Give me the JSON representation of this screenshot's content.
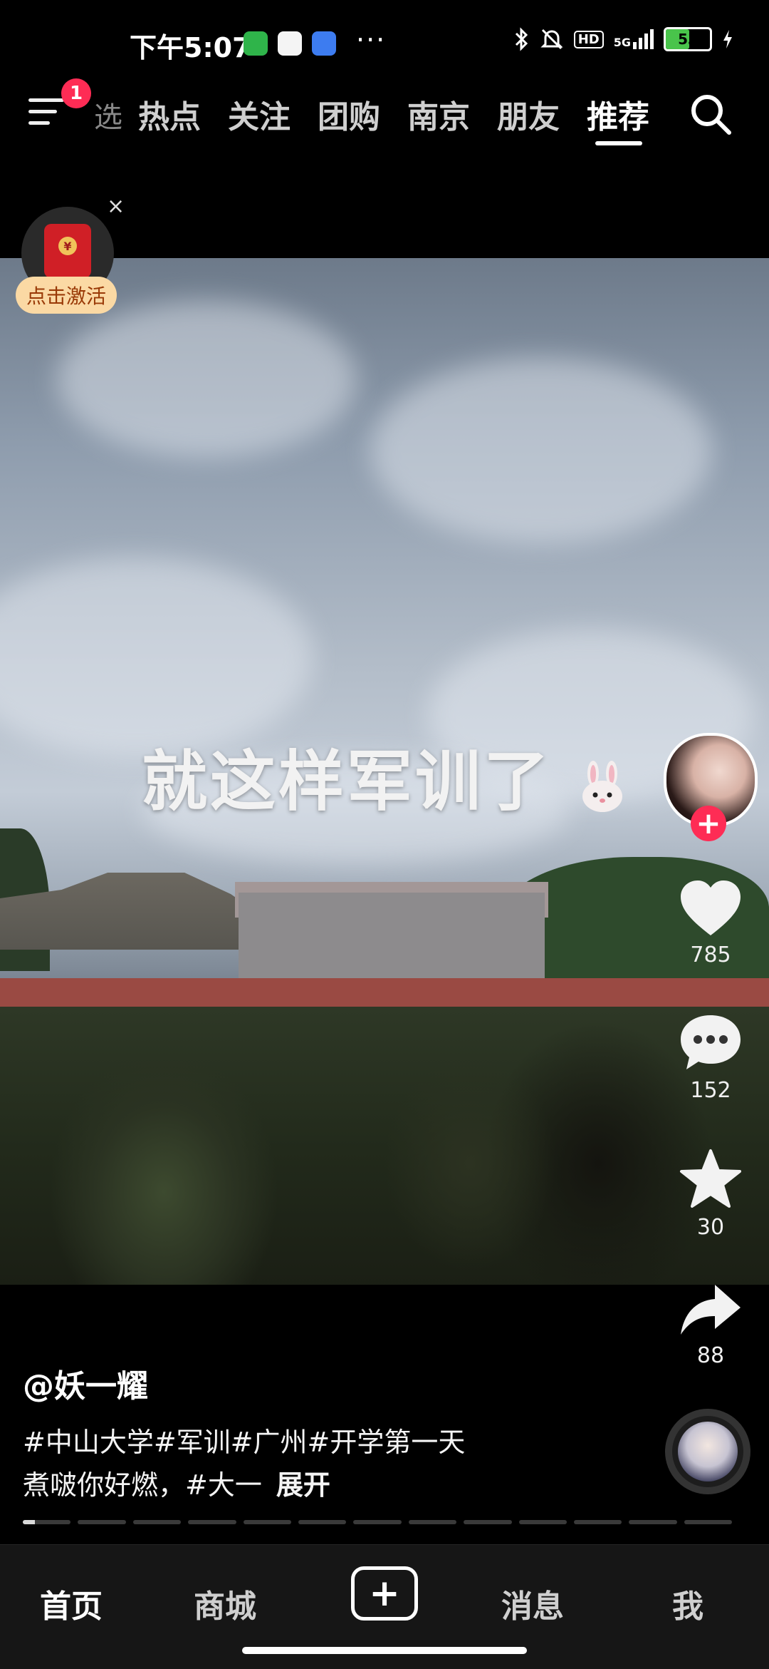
{
  "status_bar": {
    "time": "下午5:07",
    "more": "···",
    "network": "5G",
    "hd": "HD",
    "battery_level": "53",
    "battery_fraction": 0.53
  },
  "top_nav": {
    "menu_badge": "1",
    "faded_tab": "选",
    "tabs": [
      {
        "label": "热点",
        "active": false
      },
      {
        "label": "关注",
        "active": false
      },
      {
        "label": "团购",
        "active": false
      },
      {
        "label": "南京",
        "active": false
      },
      {
        "label": "朋友",
        "active": false
      },
      {
        "label": "推荐",
        "active": true
      }
    ]
  },
  "red_packet": {
    "seal": "¥",
    "close": "×",
    "activate_label": "点击激活"
  },
  "video": {
    "caption": "就这样军训了",
    "progress_segments": 13,
    "current_segment": 0,
    "current_progress": 0.25
  },
  "actions": {
    "follow": "+",
    "likes": "785",
    "comments": "152",
    "favorites": "30",
    "shares": "88"
  },
  "post": {
    "author": "@妖一耀",
    "hashtags": "#中山大学#军训#广州#开学第一天",
    "description": "煮啵你好燃，#大一",
    "expand_label": "展开"
  },
  "bottom_nav": {
    "home": "首页",
    "mall": "商城",
    "create": "+",
    "messages": "消息",
    "me": "我"
  },
  "colors": {
    "accent": "#fe2c55",
    "battery": "#49c44b",
    "activate_bg": "#fbd9a4"
  }
}
